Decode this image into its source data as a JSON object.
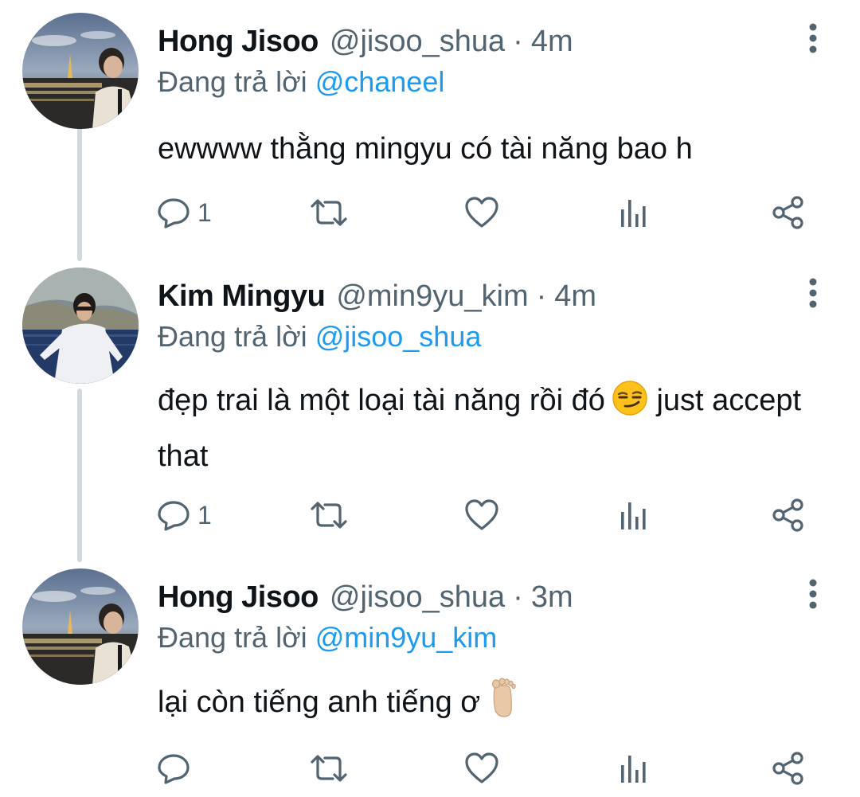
{
  "reply_prefix": "Đang trả lời",
  "tweets": [
    {
      "name": "Hong Jisoo",
      "handle": "@jisoo_shua",
      "separator": "·",
      "time": "4m",
      "reply_to": "@chaneel",
      "text": "ewwww thằng mingyu có tài năng bao h",
      "emoji": "",
      "text_after": "",
      "reply_count": "1",
      "avatar": "night-city-portrait"
    },
    {
      "name": "Kim Mingyu",
      "handle": "@min9yu_kim",
      "separator": "·",
      "time": "4m",
      "reply_to": "@jisoo_shua",
      "text": "đẹp trai là một loại tài năng rồi đó",
      "emoji": "smirking-face",
      "text_after": "just accept that",
      "reply_count": "1",
      "avatar": "seaside-cliff-portrait"
    },
    {
      "name": "Hong Jisoo",
      "handle": "@jisoo_shua",
      "separator": "·",
      "time": "3m",
      "reply_to": "@min9yu_kim",
      "text": "lại còn tiếng anh tiếng ơ",
      "emoji": "foot",
      "text_after": "",
      "reply_count": "",
      "avatar": "night-city-portrait"
    }
  ],
  "icons": {
    "reply": "speech-bubble-icon",
    "retweet": "retweet-icon",
    "like": "heart-icon",
    "views": "bar-chart-icon",
    "share": "share-icon",
    "more": "vertical-dots-icon"
  },
  "colors": {
    "text": "#0f1419",
    "secondary": "#536471",
    "mention": "#1d9bf0",
    "thread_line": "#cfd9de"
  }
}
